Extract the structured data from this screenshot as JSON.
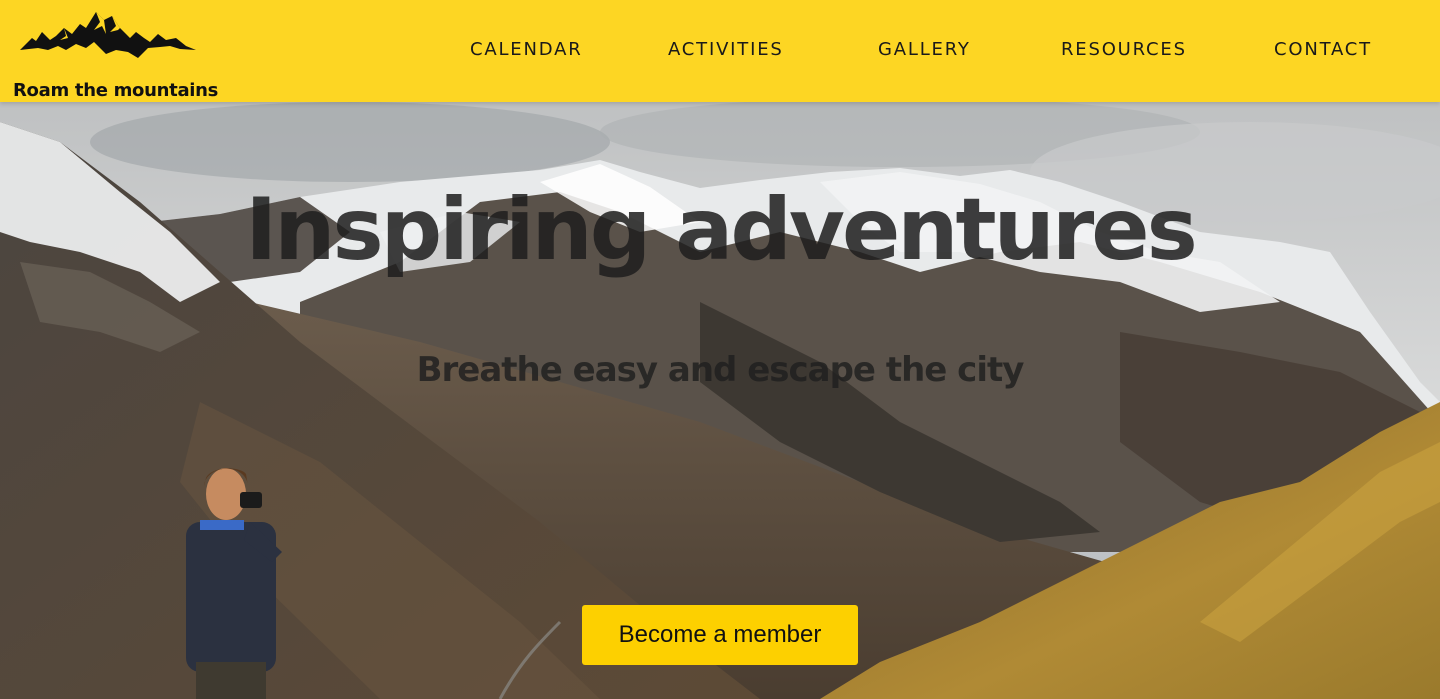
{
  "header": {
    "logo_icon": "mountain-range-icon",
    "tagline": "Roam the mountains",
    "background_color": "#fdd623",
    "nav": [
      {
        "id": "calendar",
        "label": "CALENDAR"
      },
      {
        "id": "activities",
        "label": "ACTIVITIES"
      },
      {
        "id": "gallery",
        "label": "GALLERY"
      },
      {
        "id": "resources",
        "label": "RESOURCES"
      },
      {
        "id": "contact",
        "label": "CONTACT"
      }
    ]
  },
  "hero": {
    "title": "Inspiring adventures",
    "subtitle": "Breathe easy and escape the city",
    "cta_label": "Become a member",
    "cta_color": "#fdd000"
  }
}
